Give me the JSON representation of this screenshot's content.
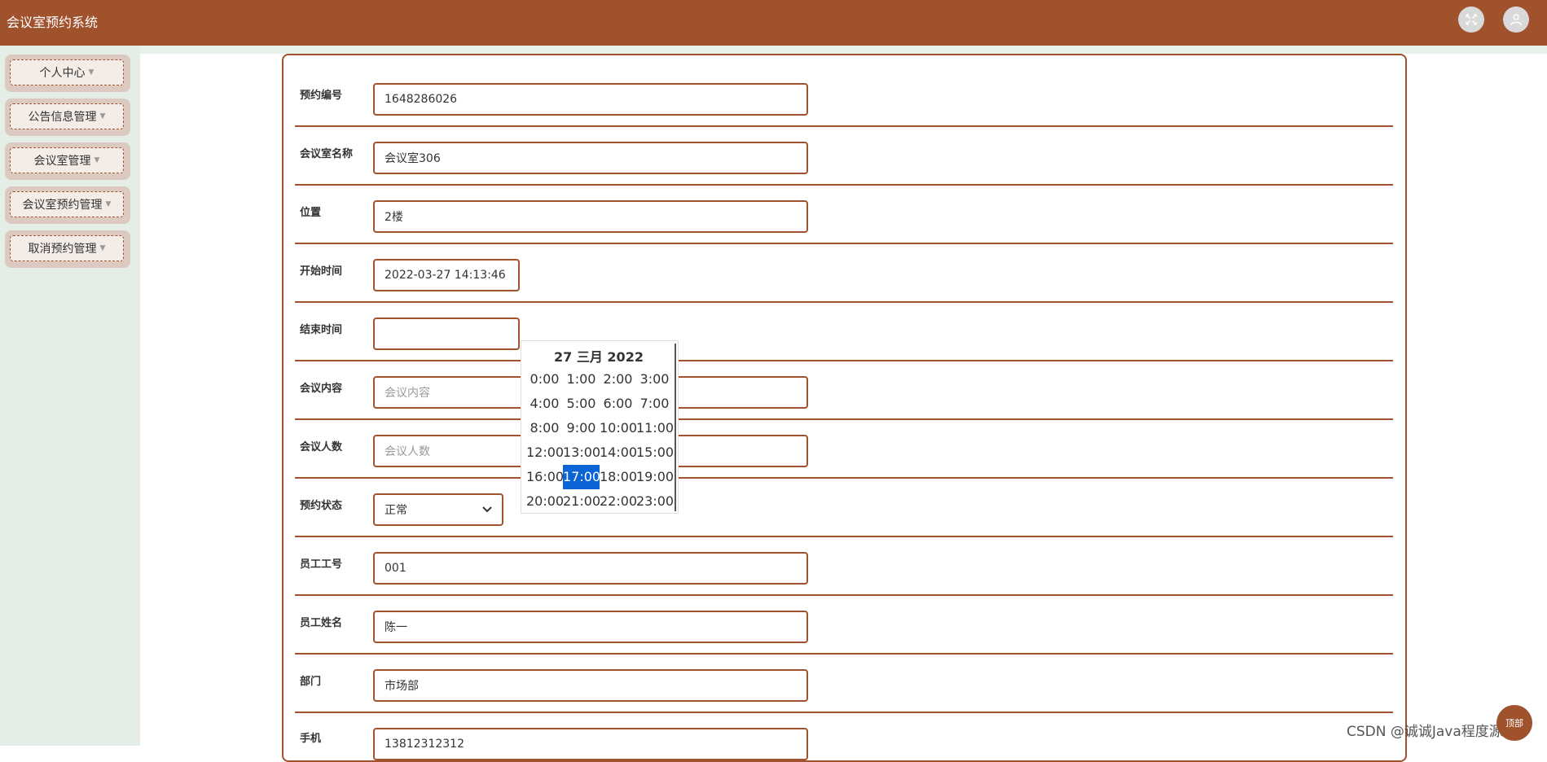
{
  "app": {
    "title": "会议室预约系统"
  },
  "header": {
    "fullscreen_icon": "fullscreen-icon",
    "user_icon": "user-icon"
  },
  "sidebar": {
    "items": [
      {
        "label": "个人中心"
      },
      {
        "label": "公告信息管理"
      },
      {
        "label": "会议室管理"
      },
      {
        "label": "会议室预约管理"
      },
      {
        "label": "取消预约管理"
      }
    ]
  },
  "form": {
    "booking_no": {
      "label": "预约编号",
      "value": "1648286026"
    },
    "room_name": {
      "label": "会议室名称",
      "value": "会议室306"
    },
    "location": {
      "label": "位置",
      "value": "2楼"
    },
    "start_time": {
      "label": "开始时间",
      "value": "2022-03-27 14:13:46"
    },
    "end_time": {
      "label": "结束时间",
      "value": ""
    },
    "content": {
      "label": "会议内容",
      "placeholder": "会议内容"
    },
    "count": {
      "label": "会议人数",
      "placeholder": "会议人数"
    },
    "status": {
      "label": "预约状态",
      "value": "正常"
    },
    "employee_no": {
      "label": "员工工号",
      "value": "001"
    },
    "employee_name": {
      "label": "员工姓名",
      "value": "陈一"
    },
    "department": {
      "label": "部门",
      "value": "市场部"
    },
    "phone": {
      "label": "手机",
      "value": "13812312312"
    }
  },
  "time_picker": {
    "title": "27 三月 2022",
    "hours": [
      "0:00",
      "1:00",
      "2:00",
      "3:00",
      "4:00",
      "5:00",
      "6:00",
      "7:00",
      "8:00",
      "9:00",
      "10:00",
      "11:00",
      "12:00",
      "13:00",
      "14:00",
      "15:00",
      "16:00",
      "17:00",
      "18:00",
      "19:00",
      "20:00",
      "21:00",
      "22:00",
      "23:00"
    ],
    "selected": "17:00"
  },
  "footer": {
    "watermark": "CSDN @诚诚Java程度源码",
    "fab_label": "顶部"
  }
}
